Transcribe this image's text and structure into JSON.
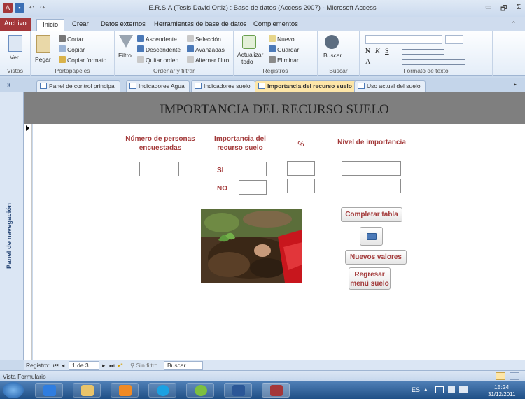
{
  "window": {
    "title": "E.R.S.A (Tesis David Ortiz) : Base de datos (Access 2007)  -  Microsoft Access",
    "controls": [
      "▭",
      "🗗",
      "Σ"
    ]
  },
  "ribbon_tabs": [
    "Archivo",
    "Inicio",
    "Crear",
    "Datos externos",
    "Herramientas de base de datos",
    "Complementos"
  ],
  "ribbon": {
    "vistas": {
      "ver": "Ver",
      "label": "Vistas"
    },
    "portapapeles": {
      "pegar": "Pegar",
      "cortar": "Cortar",
      "copiar": "Copiar",
      "copiar_formato": "Copiar formato",
      "label": "Portapapeles"
    },
    "ordenar": {
      "filtro": "Filtro",
      "ascendente": "Ascendente",
      "descendente": "Descendente",
      "quitar_orden": "Quitar orden",
      "seleccion": "Selección",
      "avanzadas": "Avanzadas",
      "alternar_filtro": "Alternar filtro",
      "label": "Ordenar y filtrar"
    },
    "registros": {
      "actualizar": "Actualizar",
      "todo": "todo",
      "nuevo": "Nuevo",
      "guardar": "Guardar",
      "eliminar": "Eliminar",
      "label": "Registros"
    },
    "buscar": {
      "buscar": "Buscar",
      "label": "Buscar"
    },
    "formato": {
      "label": "Formato de texto"
    }
  },
  "doc_tabs": [
    "Panel de control principal",
    "Indicadores Agua",
    "Indicadores suelo",
    "Importancia del recurso suelo",
    "Uso actual del suelo"
  ],
  "nav_pane": {
    "label": "Panel de navegación",
    "toggle": "»"
  },
  "form": {
    "title": "IMPORTANCIA DEL RECURSO SUELO",
    "headers": {
      "personas": "Número de personas encuestadas",
      "importancia": "Importancia del recurso suelo",
      "porcentaje": "%",
      "nivel": "Nivel de importancia"
    },
    "row_si": "SI",
    "row_no": "NO",
    "buttons": {
      "completar": "Completar tabla",
      "nuevos": "Nuevos valores",
      "regresar": "Regresar menú suelo"
    }
  },
  "record_nav": {
    "label": "Registro:",
    "position": "1 de 3",
    "filter": "Sin filtro",
    "search": "Buscar"
  },
  "status": {
    "view": "Vista Formulario"
  },
  "taskbar": {
    "lang": "ES",
    "time": "15:24",
    "date": "31/12/2011"
  }
}
